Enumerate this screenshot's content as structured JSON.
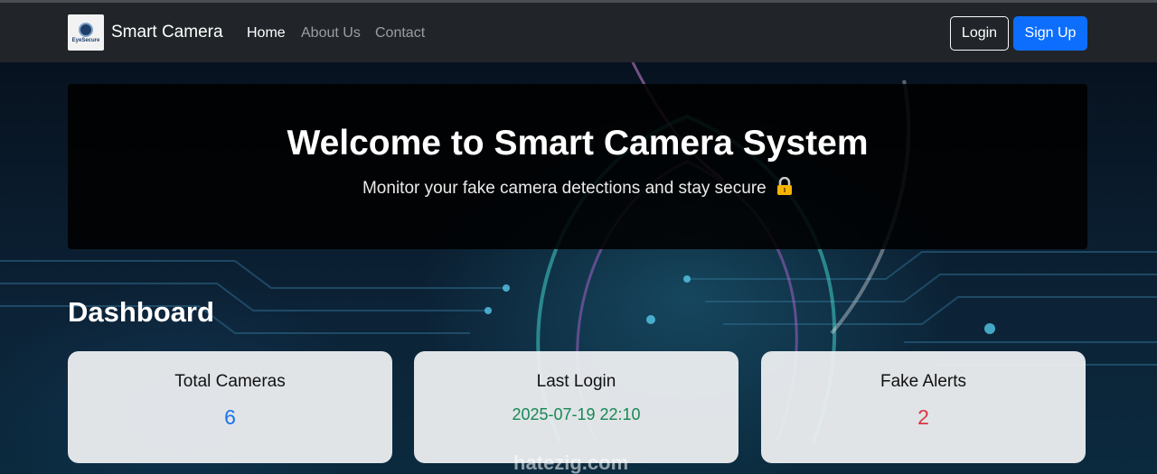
{
  "navbar": {
    "logo_text": "EyeSecure",
    "brand": "Smart Camera",
    "links": [
      "Home",
      "About Us",
      "Contact"
    ],
    "active_link": "Home",
    "login_label": "Login",
    "signup_label": "Sign Up"
  },
  "hero": {
    "title": "Welcome to Smart Camera System",
    "subtitle": "Monitor your fake camera detections and stay secure",
    "subtitle_icon": "lock-icon"
  },
  "dashboard": {
    "title": "Dashboard",
    "cards": [
      {
        "title": "Total Cameras",
        "value": "6",
        "color": "#1a73e8"
      },
      {
        "title": "Last Login",
        "value": "2025-07-19 22:10",
        "color": "#198754"
      },
      {
        "title": "Fake Alerts",
        "value": "2",
        "color": "#dc3545"
      }
    ]
  },
  "watermark": "hatezig.com",
  "colors": {
    "navbar": "#212529",
    "primary": "#0d6efd"
  }
}
